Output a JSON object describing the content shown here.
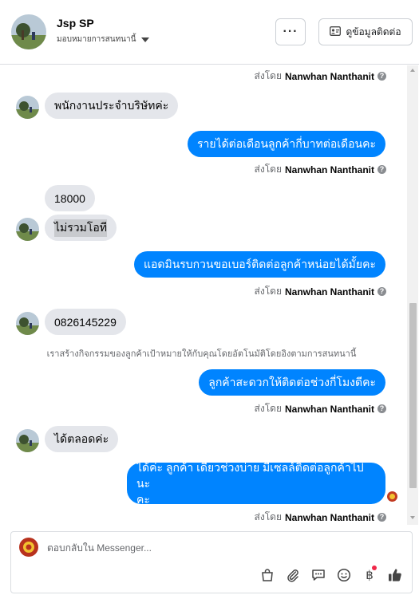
{
  "header": {
    "name": "Jsp SP",
    "assign_label": "มอบหมายการสนทนานี้",
    "more_label": "···",
    "contact_button": "ดูข้อมูลติดต่อ"
  },
  "messages": [
    {
      "sent_prefix": "ส่งโดย",
      "sent_name": "Nanwhan Nanthanit"
    },
    {
      "text": "พนักงานประจำบริษัทค่ะ"
    },
    {
      "text": "รายได้ต่อเดือนลูกค้ากี่บาทต่อเดือนคะ"
    },
    {
      "sent_prefix": "ส่งโดย",
      "sent_name": "Nanwhan Nanthanit"
    },
    {
      "text": "18000"
    },
    {
      "text": "ไม่รวมโอที"
    },
    {
      "text": "แอดมินรบกวนขอเบอร์ติดต่อลูกค้าหน่อยได้มั้ยคะ"
    },
    {
      "sent_prefix": "ส่งโดย",
      "sent_name": "Nanwhan Nanthanit"
    },
    {
      "text": "0826145229"
    },
    {
      "text": "เราสร้างกิจกรรมของลูกค้าเป้าหมายให้กับคุณโดยอัตโนมัติโดยอิงตามการสนทนานี้"
    },
    {
      "text": "ลูกค้าสะดวกให้ติดต่อช่วงกี่โมงดีคะ"
    },
    {
      "sent_prefix": "ส่งโดย",
      "sent_name": "Nanwhan Nanthanit"
    },
    {
      "text": "ได้ตลอดค่ะ"
    },
    {
      "line1": "ได้ค่ะ ลูกค้า เดี๋ยวช่วงบ่าย มีเซลล์ติดต่อลูกค้าไปนะ",
      "line2": "คะ"
    },
    {
      "sent_prefix": "ส่งโดย",
      "sent_name": "Nanwhan Nanthanit"
    }
  ],
  "composer": {
    "placeholder": "ตอบกลับใน Messenger...",
    "currency_symbol": "฿"
  }
}
